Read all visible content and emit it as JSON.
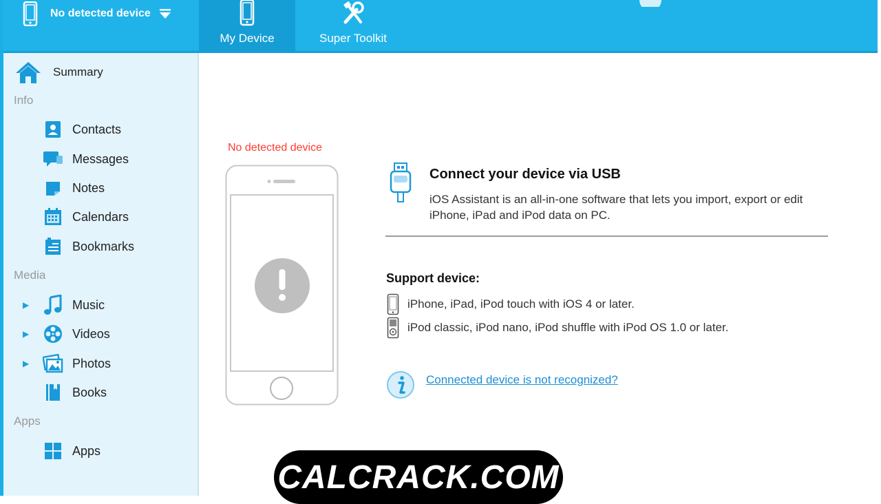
{
  "header": {
    "device_selector": "No detected device",
    "tabs": [
      {
        "label": "My Device",
        "icon": "phone-icon",
        "active": true
      },
      {
        "label": "Super Toolkit",
        "icon": "tools-icon",
        "active": false
      }
    ]
  },
  "sidebar": {
    "summary": "Summary",
    "categories": {
      "info": "Info",
      "media": "Media",
      "apps": "Apps"
    },
    "items": {
      "contacts": "Contacts",
      "messages": "Messages",
      "notes": "Notes",
      "calendars": "Calendars",
      "bookmarks": "Bookmarks",
      "music": "Music",
      "videos": "Videos",
      "photos": "Photos",
      "books": "Books",
      "apps": "Apps"
    }
  },
  "main": {
    "status": "No detected device",
    "connect_title": "Connect your device via USB",
    "connect_desc": "iOS Assistant is an all-in-one software that lets you import, export or edit iPhone, iPad and iPod data on PC.",
    "support_title": "Support device:",
    "support_items": [
      "iPhone, iPad, iPod touch with iOS 4 or later.",
      "iPod classic, iPod nano, iPod shuffle with iPod OS 1.0 or later."
    ],
    "help_link": "Connected device is not recognized?"
  },
  "watermark": "CALCRACK.COM",
  "colors": {
    "accent": "#1fb3ea",
    "sidebar_bg": "#e3f4fc",
    "alert_red": "#ff3b30",
    "link": "#1a8fd6"
  }
}
